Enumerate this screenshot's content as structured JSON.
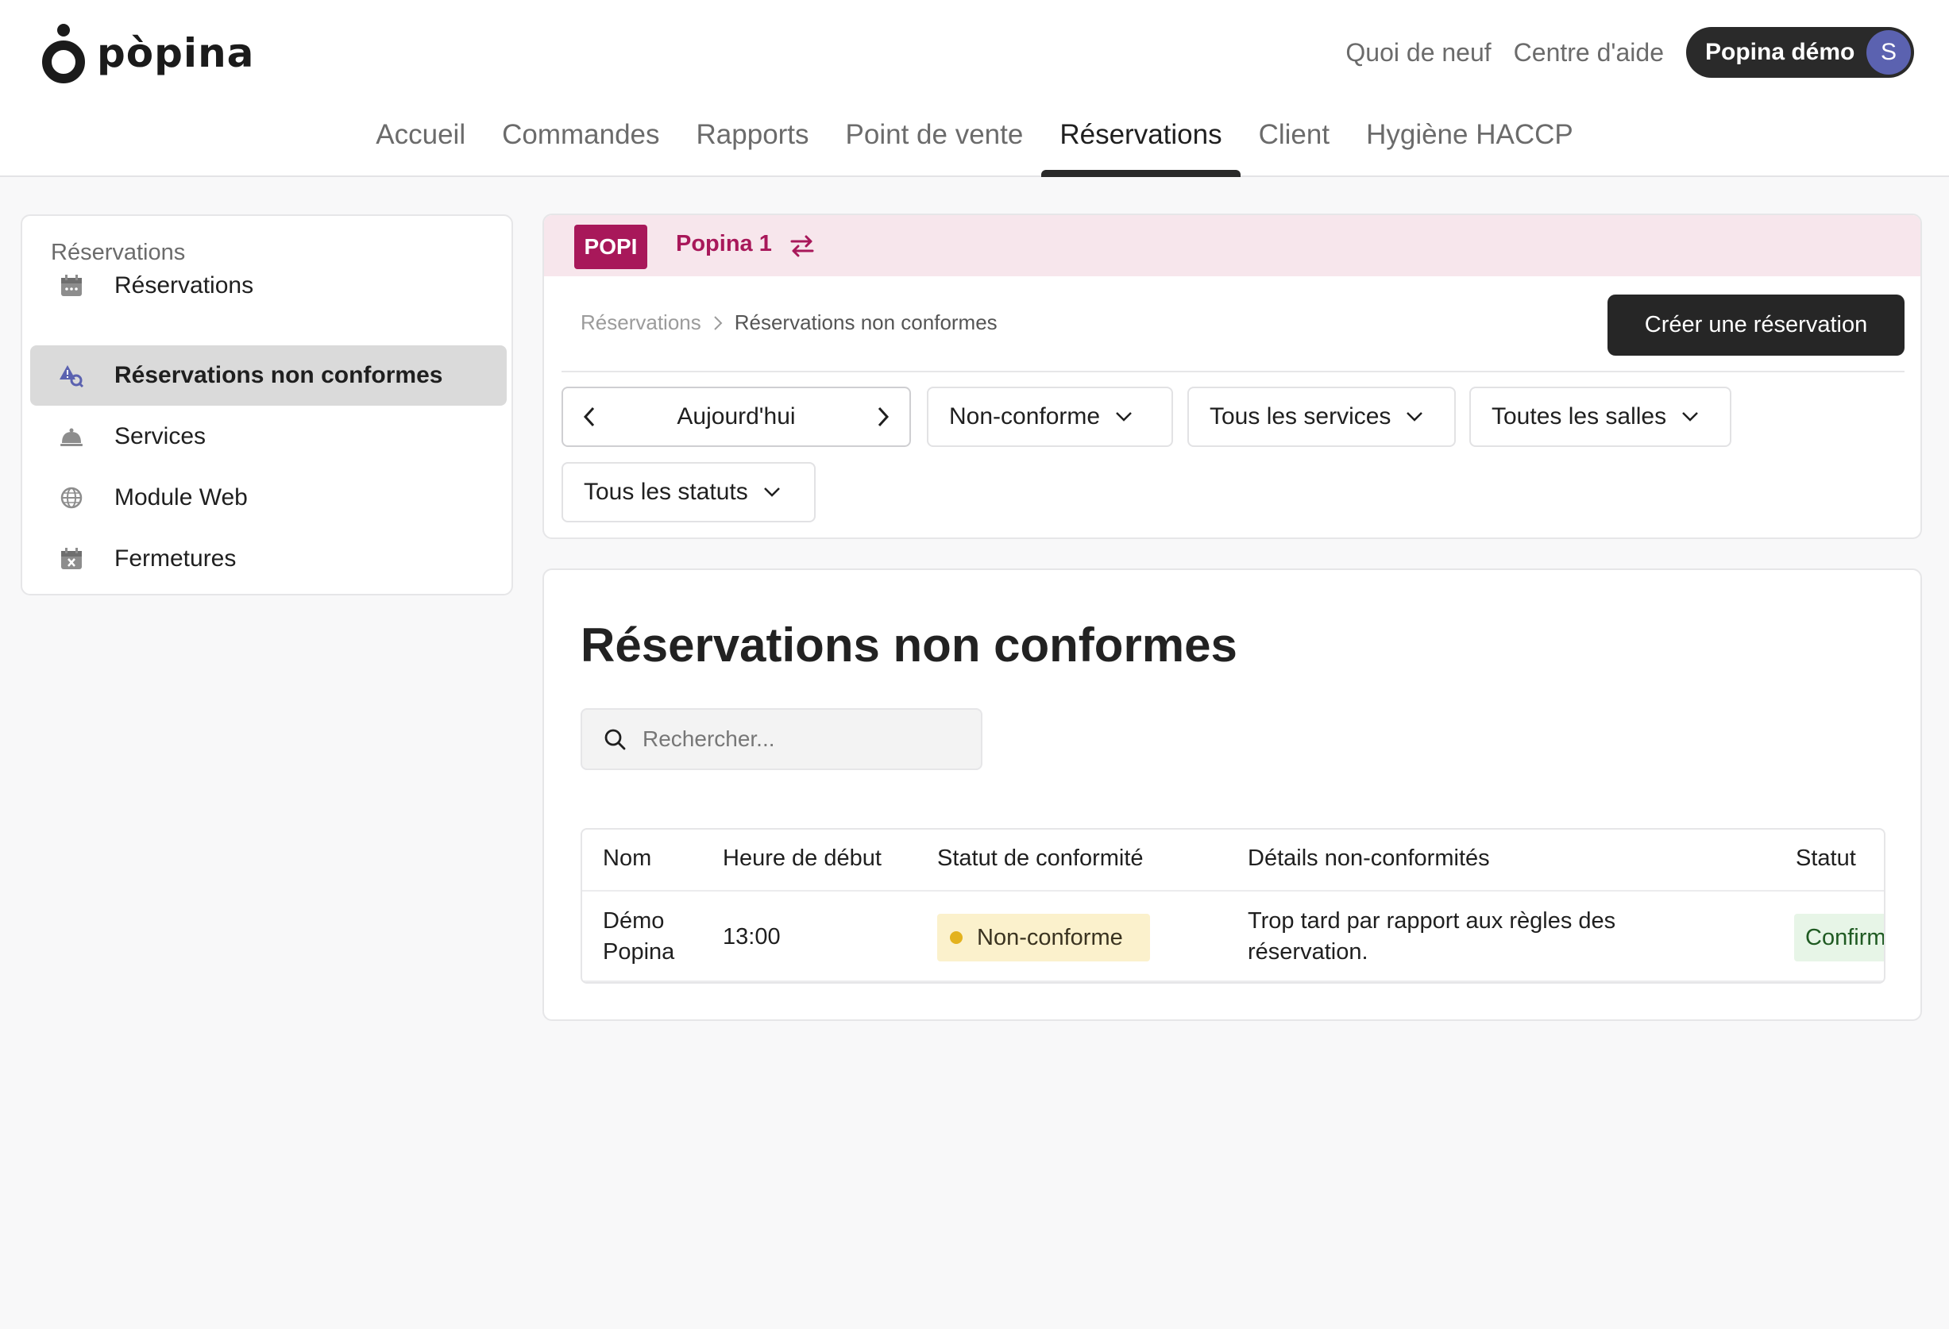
{
  "header": {
    "logo_text": "pòpina",
    "links": {
      "whats_new": "Quoi de neuf",
      "help_center": "Centre d'aide"
    },
    "user": {
      "name": "Popina démo",
      "initial": "S",
      "avatar_color": "#5b62b0"
    }
  },
  "nav": {
    "items": [
      "Accueil",
      "Commandes",
      "Rapports",
      "Point de vente",
      "Réservations",
      "Client",
      "Hygiène HACCP"
    ],
    "active": "Réservations"
  },
  "sidebar": {
    "title": "Réservations",
    "items": [
      {
        "label": "Réservations",
        "icon": "calendar-icon"
      },
      {
        "label": "Réservations non conformes",
        "icon": "nonconform-icon",
        "active": true
      },
      {
        "label": "Services",
        "icon": "service-bell-icon"
      },
      {
        "label": "Module Web",
        "icon": "globe-icon"
      },
      {
        "label": "Fermetures",
        "icon": "calendar-x-icon"
      }
    ]
  },
  "venue": {
    "badge": "POPI",
    "name": "Popina 1",
    "color": "#a8185a",
    "bg": "#f7e6ec"
  },
  "breadcrumb": {
    "root": "Réservations",
    "current": "Réservations non conformes"
  },
  "actions": {
    "create": "Créer une réservation"
  },
  "filters": {
    "date": "Aujourd'hui",
    "conformity": "Non-conforme",
    "services": "Tous les services",
    "rooms": "Toutes les salles",
    "statuses": "Tous les statuts"
  },
  "main": {
    "title": "Réservations non conformes",
    "search_placeholder": "Rechercher..."
  },
  "table": {
    "columns": [
      "Nom",
      "Heure de début",
      "Statut de conformité",
      "Détails non-conformités",
      "Statut"
    ],
    "rows": [
      {
        "name_line1": "Démo",
        "name_line2": "Popina",
        "start": "13:00",
        "conformity": "Non-conforme",
        "details_line1": "Trop tard par rapport aux règles des",
        "details_line2": "réservation.",
        "status": "Confirm"
      }
    ]
  }
}
